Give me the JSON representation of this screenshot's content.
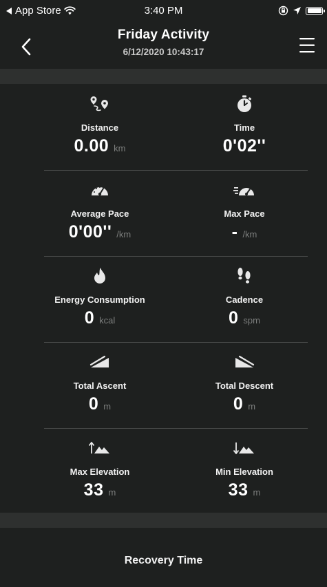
{
  "status_bar": {
    "back_app": "App Store",
    "time": "3:40 PM"
  },
  "header": {
    "title": "Friday Activity",
    "datetime": "6/12/2020 10:43:17"
  },
  "metrics": [
    {
      "left": {
        "icon": "distance-route-icon",
        "label": "Distance",
        "value": "0.00",
        "unit": "km"
      },
      "right": {
        "icon": "stopwatch-icon",
        "label": "Time",
        "value": "0'02''",
        "unit": ""
      }
    },
    {
      "left": {
        "icon": "speedometer-icon",
        "label": "Average Pace",
        "value": "0'00''",
        "unit": "/km"
      },
      "right": {
        "icon": "fast-speedometer-icon",
        "label": "Max Pace",
        "value": "-",
        "unit": "/km"
      }
    },
    {
      "left": {
        "icon": "flame-icon",
        "label": "Energy Consumption",
        "value": "0",
        "unit": "kcal"
      },
      "right": {
        "icon": "footprints-icon",
        "label": "Cadence",
        "value": "0",
        "unit": "spm"
      }
    },
    {
      "left": {
        "icon": "ascent-icon",
        "label": "Total Ascent",
        "value": "0",
        "unit": "m"
      },
      "right": {
        "icon": "descent-icon",
        "label": "Total Descent",
        "value": "0",
        "unit": "m"
      }
    },
    {
      "left": {
        "icon": "max-elevation-icon",
        "label": "Max Elevation",
        "value": "33",
        "unit": "m"
      },
      "right": {
        "icon": "min-elevation-icon",
        "label": "Min Elevation",
        "value": "33",
        "unit": "m"
      }
    }
  ],
  "recovery": {
    "title": "Recovery Time"
  },
  "colors": {
    "background": "#1e201f",
    "band": "#2e302f",
    "divider": "#4b4d4c",
    "unit_text": "#7d7f7e",
    "icon": "#e8e8e8"
  }
}
